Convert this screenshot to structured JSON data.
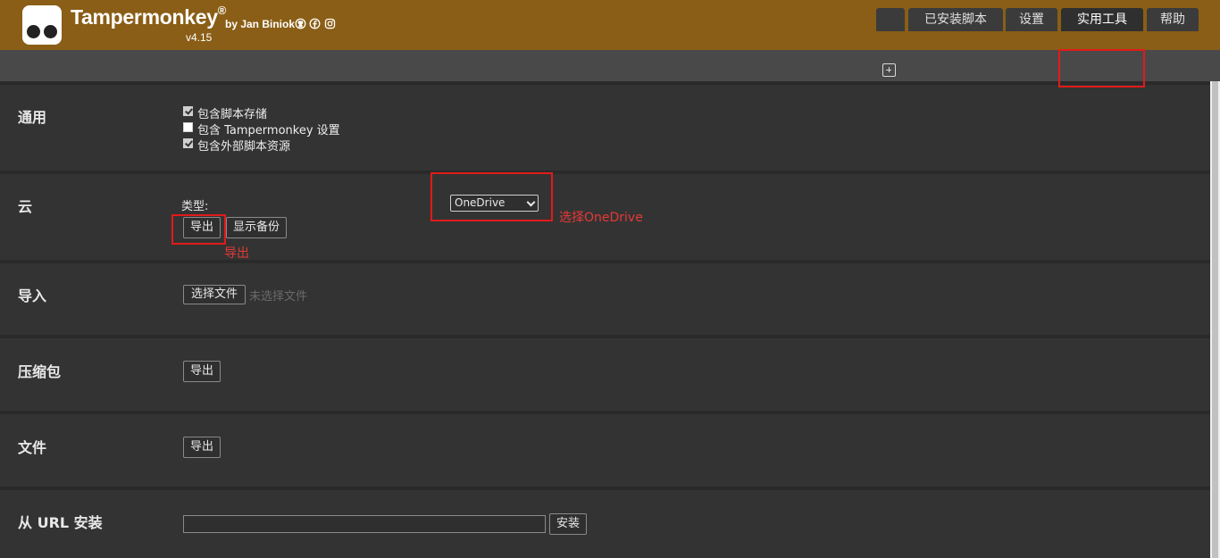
{
  "header": {
    "app_name": "Tampermonkey",
    "registered": "®",
    "version": "v4.15",
    "author": "by Jan Biniok",
    "social_icons": [
      "github-icon",
      "facebook-icon",
      "instagram-icon"
    ],
    "color": "#8a5e16"
  },
  "tabs": {
    "add_icon": "plus-square-icon",
    "installed": "已安装脚本",
    "settings": "设置",
    "utilities": "实用工具",
    "help": "帮助",
    "active": "实用工具"
  },
  "general": {
    "label": "通用",
    "options": [
      {
        "label": "包含脚本存储",
        "checked": true
      },
      {
        "label": "包含 Tampermonkey 设置",
        "checked": false
      },
      {
        "label": "包含外部脚本资源",
        "checked": true
      }
    ]
  },
  "cloud": {
    "label": "云",
    "type_label": "类型:",
    "type_value": "OneDrive",
    "export_button": "导出",
    "show_backup_button": "显示备份"
  },
  "import": {
    "label": "导入",
    "choose_file_button": "选择文件",
    "no_file_text": "未选择文件"
  },
  "zip": {
    "label": "压缩包",
    "export_button": "导出"
  },
  "file": {
    "label": "文件",
    "export_button": "导出"
  },
  "url_install": {
    "label": "从 URL 安装",
    "input_value": "",
    "install_button": "安装"
  },
  "annotations": {
    "select_note": "选择OneDrive",
    "export_note": "导出",
    "color": "#e21a1a"
  }
}
